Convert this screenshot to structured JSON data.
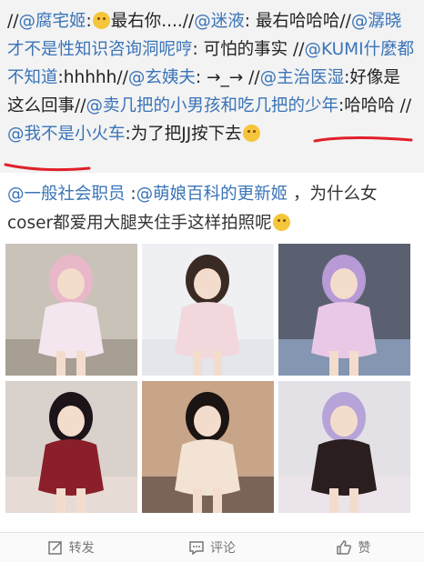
{
  "repost": {
    "segments": [
      {
        "text": "//",
        "link": false
      },
      {
        "text": "@腐宅姬",
        "link": true
      },
      {
        "text": ":",
        "link": false
      },
      {
        "emoji": "cat-face"
      },
      {
        "text": "最右你....//",
        "link": false
      },
      {
        "text": "@迷液",
        "link": true
      },
      {
        "text": ": 最右哈哈哈//",
        "link": false
      },
      {
        "text": "@潺晓才不是性知识咨询洞呢哼",
        "link": true
      },
      {
        "text": ": 可怕的事实 //",
        "link": false
      },
      {
        "text": "@KUMI什麼都不知道",
        "link": true
      },
      {
        "text": ":hhhhh//",
        "link": false
      },
      {
        "text": "@玄姨夫",
        "link": true
      },
      {
        "text": ": →_→ //",
        "link": false
      },
      {
        "text": "@主治医湿",
        "link": true
      },
      {
        "text": ":好像是这么回事//",
        "link": false
      },
      {
        "text": "@卖几把的小男孩和吃几把的少年",
        "link": true
      },
      {
        "text": ":哈哈哈 //",
        "link": false
      },
      {
        "text": "@我不是小火车",
        "link": true
      },
      {
        "text": ":为了把JJ按下去",
        "link": false
      },
      {
        "emoji": "cat-face"
      }
    ]
  },
  "original": {
    "segments": [
      {
        "text": "@一般社会职员",
        "link": true
      },
      {
        "text": " :",
        "link": false
      },
      {
        "text": "@萌娘百科的更新姬",
        "link": true
      },
      {
        "text": " ，为什么女coser都爱用大腿夹住手这样拍照呢",
        "link": false
      },
      {
        "emoji": "smile-face"
      }
    ]
  },
  "photos": [
    {
      "name": "photo-street-pink-hair",
      "palette": [
        "#c9c2b8",
        "#e8b7c8",
        "#f4e6ee",
        "#8a8276"
      ]
    },
    {
      "name": "photo-twin-tails-white",
      "palette": [
        "#eef0f3",
        "#3a2a24",
        "#f2d8dc",
        "#dcdfe6"
      ]
    },
    {
      "name": "photo-purple-hair-crowd",
      "palette": [
        "#5a6070",
        "#b79ad6",
        "#e9c8e6",
        "#a7c2e8"
      ]
    },
    {
      "name": "photo-plaid-dress",
      "palette": [
        "#d9d2cc",
        "#1c1418",
        "#8a1f2a",
        "#f0e2dc"
      ]
    },
    {
      "name": "photo-checker-dress",
      "palette": [
        "#c8a488",
        "#1a1412",
        "#f3e3d5",
        "#3a3030"
      ]
    },
    {
      "name": "photo-lavender-hoodie",
      "palette": [
        "#e3e1e6",
        "#b6a4d8",
        "#2a1e1e",
        "#f2e8ee"
      ]
    }
  ],
  "actions": [
    {
      "label": "转发",
      "icon": "repost-icon"
    },
    {
      "label": "评论",
      "icon": "comment-icon"
    },
    {
      "label": "赞",
      "icon": "like-icon"
    }
  ],
  "colors": {
    "link": "#3a74b8",
    "underline": "#e0202a",
    "repost_bg": "#f3f3f3"
  }
}
